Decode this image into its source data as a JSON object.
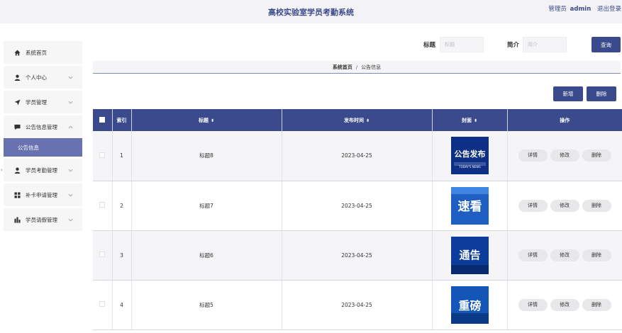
{
  "header": {
    "title": "高校实验室学员考勤系统",
    "role": "管理员",
    "username": "admin",
    "logout": "退出登录"
  },
  "sidebar": {
    "items": [
      {
        "label": "系统首页",
        "icon": "home-icon"
      },
      {
        "label": "个人中心",
        "icon": "user-icon"
      },
      {
        "label": "学员管理",
        "icon": "send-icon"
      },
      {
        "label": "公告信息管理",
        "icon": "message-icon",
        "expanded": true,
        "children": [
          "公告信息"
        ]
      },
      {
        "label": "学员考勤管理",
        "icon": "user-icon"
      },
      {
        "label": "补卡申请管理",
        "icon": "grid-icon"
      },
      {
        "label": "学员请假管理",
        "icon": "chart-icon"
      }
    ]
  },
  "search": {
    "title_label": "标题",
    "title_placeholder": "标题",
    "intro_label": "简介",
    "intro_placeholder": "简介",
    "query_button": "查询"
  },
  "breadcrumb": {
    "home": "系统首页",
    "separator": "/",
    "current": "公告信息"
  },
  "actions": {
    "add": "新增",
    "delete": "删除"
  },
  "table": {
    "columns": [
      "索引",
      "标题",
      "发布时间",
      "封面",
      "操作"
    ],
    "rows": [
      {
        "index": "1",
        "title": "标题8",
        "time": "2023-04-25",
        "cover_lines": [
          "公告发布",
          "TODAY'S NEWS"
        ]
      },
      {
        "index": "2",
        "title": "标题7",
        "time": "2023-04-25",
        "cover_lines": [
          "速看",
          ""
        ]
      },
      {
        "index": "3",
        "title": "标题6",
        "time": "2023-04-25",
        "cover_lines": [
          "通告",
          ""
        ]
      },
      {
        "index": "4",
        "title": "标题5",
        "time": "2023-04-25",
        "cover_lines": [
          "重磅",
          ""
        ]
      }
    ],
    "row_actions": {
      "detail": "详情",
      "edit": "修改",
      "delete": "删除"
    }
  }
}
